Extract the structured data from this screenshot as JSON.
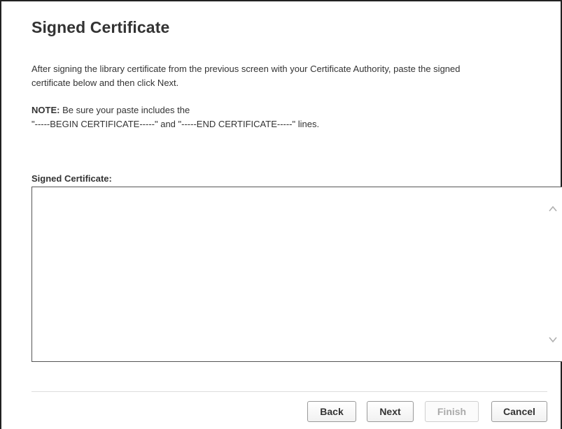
{
  "dialog": {
    "title": "Signed Certificate",
    "intro_line1": "After signing the library certificate from the previous screen with your Certificate Authority, paste the signed",
    "intro_line2": "certificate below and then click Next.",
    "note_label": "NOTE:",
    "note_line1": " Be sure your paste includes the",
    "note_line2": "\"-----BEGIN CERTIFICATE-----\" and \"-----END CERTIFICATE-----\" lines.",
    "field_label": "Signed Certificate:",
    "field_value": ""
  },
  "buttons": {
    "back": "Back",
    "next": "Next",
    "finish": "Finish",
    "cancel": "Cancel"
  },
  "icons": {
    "scroll_up": "chevron-up-icon",
    "scroll_down": "chevron-down-icon"
  }
}
